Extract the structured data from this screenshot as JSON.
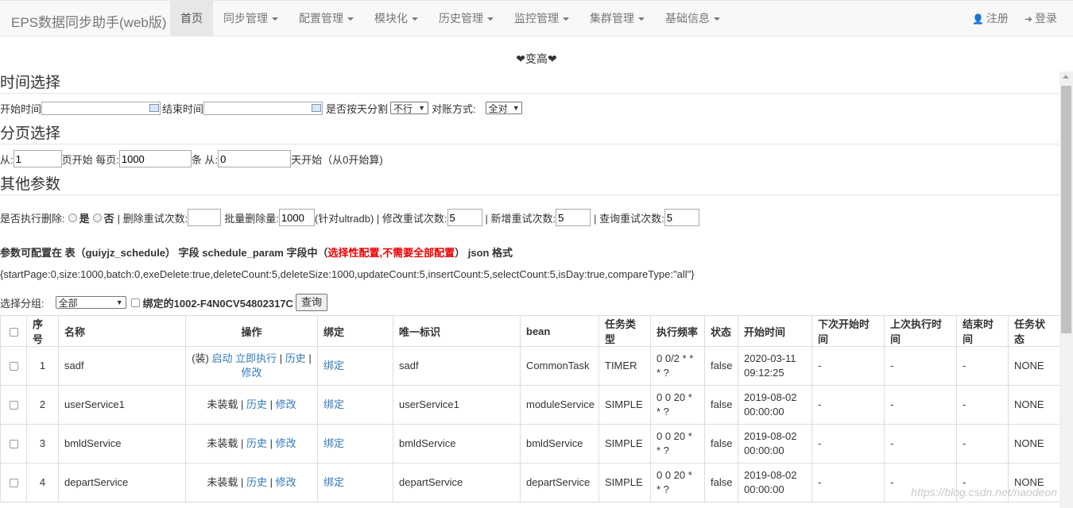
{
  "nav": {
    "brand": "EPS数据同步助手(web版)",
    "items": [
      {
        "label": "首页",
        "active": true,
        "dropdown": false
      },
      {
        "label": "同步管理",
        "dropdown": true
      },
      {
        "label": "配置管理",
        "dropdown": true
      },
      {
        "label": "模块化",
        "dropdown": true
      },
      {
        "label": "历史管理",
        "dropdown": true
      },
      {
        "label": "监控管理",
        "dropdown": true
      },
      {
        "label": "集群管理",
        "dropdown": true
      },
      {
        "label": "基础信息",
        "dropdown": true
      }
    ],
    "register": "注册",
    "login": "登录"
  },
  "banner": "❤变高❤",
  "time_section": {
    "legend": "时间选择",
    "start_label": "开始时间",
    "start_value": "",
    "end_label": "结束时间",
    "end_value": "",
    "split_label": "是否按天分割",
    "split_value": "不行",
    "compare_label": "对账方式:",
    "compare_value": "全对"
  },
  "page_section": {
    "legend": "分页选择",
    "from_label": "从:",
    "from_value": "1",
    "page_start_label": "页开始 每页:",
    "per_page_value": "1000",
    "per_unit": "条 从:",
    "day_value": "0",
    "day_suffix": "天开始（从0开始算)"
  },
  "other_section": {
    "legend": "其他参数",
    "exec_delete_label": "是否执行删除:",
    "yes": "是",
    "no": "否",
    "del_retry_label": "| 删除重试次数:",
    "del_retry_value": "",
    "batch_del_label": "批量删除量:",
    "batch_del_value": "1000",
    "batch_note": "(针对ultradb) | 修改重试次数:",
    "update_retry_value": "5",
    "insert_label": "| 新增重试次数:",
    "insert_retry_value": "5",
    "query_label": "| 查询重试次数:",
    "query_retry_value": "5"
  },
  "note": {
    "prefix": "参数可配置在 表（guiyjz_schedule） 字段 schedule_param 字段中（",
    "red": "选择性配置,不需要全部配置",
    "suffix": "） json 格式"
  },
  "json_example": "{startPage:0,size:1000,batch:0,exeDelete:true,deleteCount:5,deleteSize:1000,updateCount:5,insertCount:5,selectCount:5,isDay:true,compareType:\"all\"}",
  "group": {
    "label": "选择分组:",
    "value": "全部",
    "bind_label": "绑定的1002-F4N0CV54802317C",
    "query_button": "查询"
  },
  "table": {
    "headers": [
      "",
      "序号",
      "名称",
      "操作",
      "绑定",
      "唯一标识",
      "bean",
      "任务类型",
      "执行频率",
      "状态",
      "开始时间",
      "下次开始时间",
      "上次执行时间",
      "结束时间",
      "任务状态"
    ],
    "rows": [
      {
        "no": "1",
        "name": "sadf",
        "ops": [
          "(装)",
          "启动",
          "立即执行",
          "|",
          "历史",
          "|",
          "修改"
        ],
        "bind": "绑定",
        "uid": "sadf",
        "bean": "CommonTask",
        "type": "TIMER",
        "freq": "0 0/2 * * * ?",
        "status": "false",
        "start": "2020-03-11 09:12:25",
        "next": "-",
        "last": "-",
        "end": "-",
        "task_status": "NONE"
      },
      {
        "no": "2",
        "name": "userService1",
        "ops": [
          "未装载",
          "|",
          "历史",
          "|",
          "修改"
        ],
        "bind": "绑定",
        "uid": "userService1",
        "bean": "moduleService",
        "type": "SIMPLE",
        "freq": "0 0 20 * * ?",
        "status": "false",
        "start": "2019-08-02 00:00:00",
        "next": "-",
        "last": "-",
        "end": "-",
        "task_status": "NONE"
      },
      {
        "no": "3",
        "name": "bmldService",
        "ops": [
          "未装载",
          "|",
          "历史",
          "|",
          "修改"
        ],
        "bind": "绑定",
        "uid": "bmldService",
        "bean": "bmldService",
        "type": "SIMPLE",
        "freq": "0 0 20 * * ?",
        "status": "false",
        "start": "2019-08-02 00:00:00",
        "next": "-",
        "last": "-",
        "end": "-",
        "task_status": "NONE"
      },
      {
        "no": "4",
        "name": "departService",
        "ops": [
          "未装载",
          "|",
          "历史",
          "|",
          "修改"
        ],
        "bind": "绑定",
        "uid": "departService",
        "bean": "departService",
        "type": "SIMPLE",
        "freq": "0 0 20 * * ?",
        "status": "false",
        "start": "2019-08-02 00:00:00",
        "next": "-",
        "last": "-",
        "end": "-",
        "task_status": "NONE"
      }
    ]
  },
  "watermark": "https://blog.csdn.net/naodeon"
}
